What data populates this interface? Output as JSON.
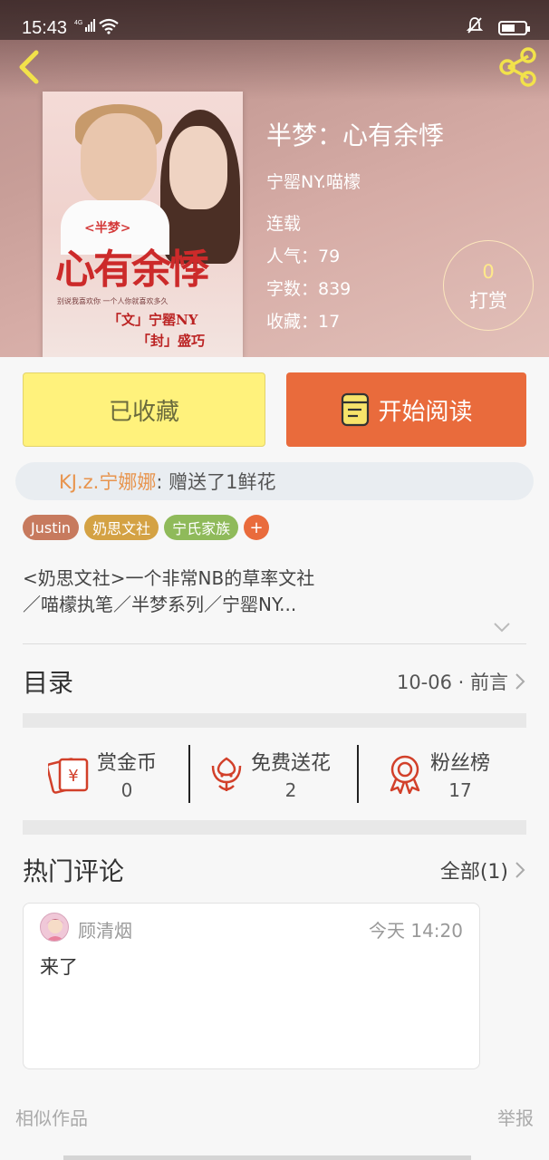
{
  "status_bar": {
    "time": "15:43",
    "network": "4G",
    "icons": [
      "signal-icon",
      "wifi-icon",
      "silent-icon",
      "battery-icon"
    ]
  },
  "header": {
    "back_icon": "back-chevron-icon",
    "share_icon": "share-icon"
  },
  "book": {
    "title": "半梦：心有余悸",
    "author": "宁罂NY.喵檬",
    "status": "连载",
    "popularity": "人气：79",
    "words": "字数：839",
    "favorites": "收藏：17",
    "cover_art": {
      "tag": "<半梦>",
      "title": "心有余悸",
      "tagline": "别说我喜欢你 一个人你就喜欢多久",
      "credit1": "「文」宁罂NY",
      "credit2": "「封」盛巧"
    }
  },
  "tip": {
    "count": "0",
    "label": "打赏"
  },
  "actions": {
    "favorited_label": "已收藏",
    "read_label": "开始阅读"
  },
  "gift": {
    "user": "KJ.z.宁娜娜",
    "text": " : 赠送了1鲜花"
  },
  "tags": [
    {
      "label": "Justin",
      "color": "#c77a5e"
    },
    {
      "label": "奶思文社",
      "color": "#d4a244"
    },
    {
      "label": "宁氏家族",
      "color": "#8fba5a"
    }
  ],
  "tag_add": "+",
  "summary": {
    "line1": "<奶思文社>一个非常NB的草率文社",
    "line2": "／喵檬执笔／半梦系列／宁罂NY..."
  },
  "toc": {
    "title": "目录",
    "latest": "10-06 · 前言"
  },
  "stats": [
    {
      "label": "赏金币",
      "value": "0",
      "icon": "coin-envelope-icon"
    },
    {
      "label": "免费送花",
      "value": "2",
      "icon": "flower-icon"
    },
    {
      "label": "粉丝榜",
      "value": "17",
      "icon": "medal-icon"
    }
  ],
  "hot_comments": {
    "title": "热门评论",
    "all_label": "全部(1)"
  },
  "comment": {
    "user": "顾清烟",
    "time": "今天 14:20",
    "body": "来了"
  },
  "footer": {
    "similar": "相似作品",
    "report": "举报"
  },
  "colors": {
    "accent_orange": "#e96b3c",
    "fav_yellow": "#fff27c",
    "tip_gold": "#ffe98a",
    "gift_user": "#e8944d"
  }
}
